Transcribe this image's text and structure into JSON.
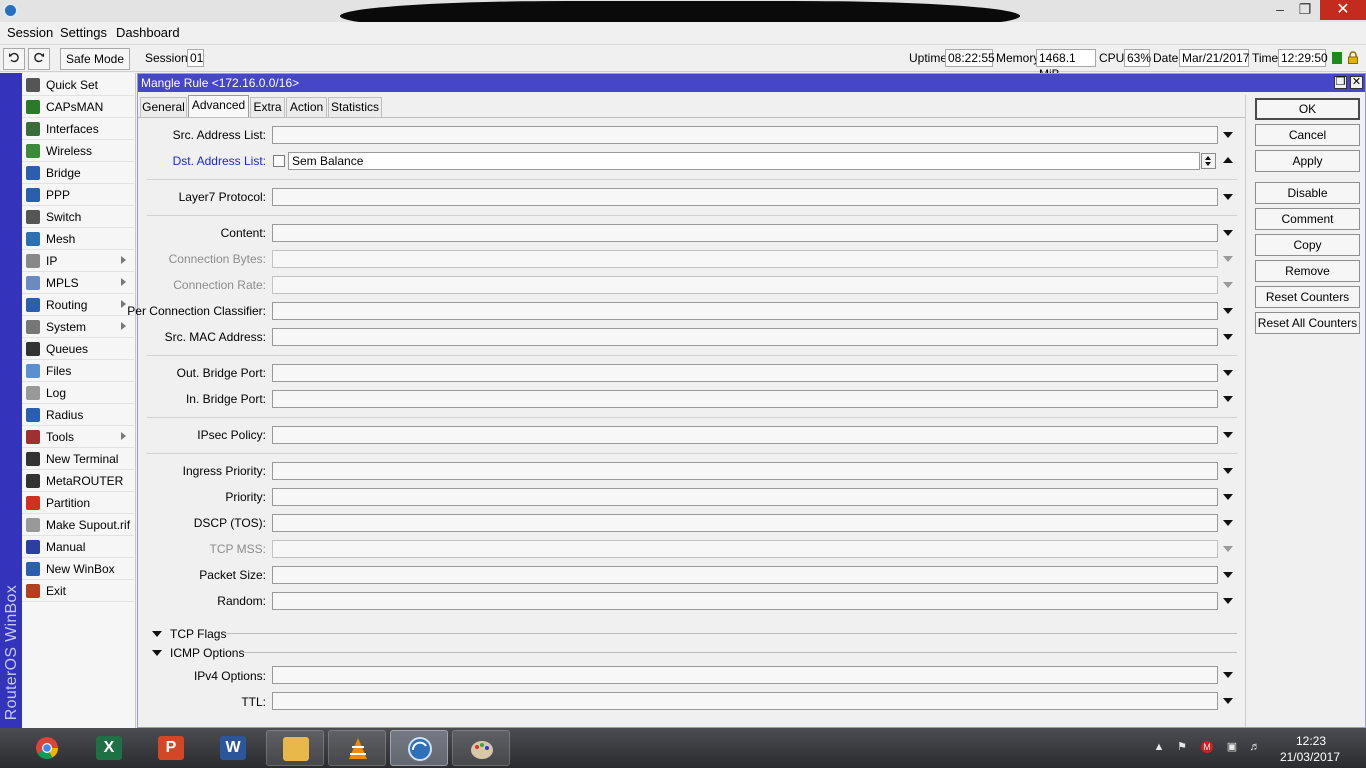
{
  "menubar": {
    "session": "Session",
    "settings": "Settings",
    "dashboard": "Dashboard"
  },
  "toolbar": {
    "safe_mode": "Safe Mode",
    "session_label": "Session:",
    "session_value": "01",
    "uptime_label": "Uptime:",
    "uptime_value": "08:22:55",
    "memory_label": "Memory:",
    "memory_value": "1468.1 MiB",
    "cpu_label": "CPU:",
    "cpu_value": "63%",
    "date_label": "Date:",
    "date_value": "Mar/21/2017",
    "time_label": "Time:",
    "time_value": "12:29:50"
  },
  "brand": "RouterOS WinBox",
  "sidebar": {
    "items": [
      {
        "label": "Quick Set",
        "icon": "quick-set-icon",
        "submenu": false
      },
      {
        "label": "CAPsMAN",
        "icon": "capsman-icon",
        "submenu": false
      },
      {
        "label": "Interfaces",
        "icon": "interfaces-icon",
        "submenu": false
      },
      {
        "label": "Wireless",
        "icon": "wireless-icon",
        "submenu": false
      },
      {
        "label": "Bridge",
        "icon": "bridge-icon",
        "submenu": false
      },
      {
        "label": "PPP",
        "icon": "ppp-icon",
        "submenu": false
      },
      {
        "label": "Switch",
        "icon": "switch-icon",
        "submenu": false
      },
      {
        "label": "Mesh",
        "icon": "mesh-icon",
        "submenu": false
      },
      {
        "label": "IP",
        "icon": "ip-icon",
        "submenu": true
      },
      {
        "label": "MPLS",
        "icon": "mpls-icon",
        "submenu": true
      },
      {
        "label": "Routing",
        "icon": "routing-icon",
        "submenu": true
      },
      {
        "label": "System",
        "icon": "system-icon",
        "submenu": true
      },
      {
        "label": "Queues",
        "icon": "queues-icon",
        "submenu": false
      },
      {
        "label": "Files",
        "icon": "files-icon",
        "submenu": false
      },
      {
        "label": "Log",
        "icon": "log-icon",
        "submenu": false
      },
      {
        "label": "Radius",
        "icon": "radius-icon",
        "submenu": false
      },
      {
        "label": "Tools",
        "icon": "tools-icon",
        "submenu": true
      },
      {
        "label": "New Terminal",
        "icon": "terminal-icon",
        "submenu": false
      },
      {
        "label": "MetaROUTER",
        "icon": "metarouter-icon",
        "submenu": false
      },
      {
        "label": "Partition",
        "icon": "partition-icon",
        "submenu": false
      },
      {
        "label": "Make Supout.rif",
        "icon": "supout-icon",
        "submenu": false
      },
      {
        "label": "Manual",
        "icon": "manual-icon",
        "submenu": false
      },
      {
        "label": "New WinBox",
        "icon": "winbox-icon",
        "submenu": false
      },
      {
        "label": "Exit",
        "icon": "exit-icon",
        "submenu": false
      }
    ]
  },
  "dialog": {
    "title": "Mangle Rule <172.16.0.0/16>",
    "tabs": [
      "General",
      "Advanced",
      "Extra",
      "Action",
      "Statistics"
    ],
    "active_tab": "Advanced",
    "fields": {
      "src_address_list": {
        "label": "Src. Address List:",
        "value": ""
      },
      "dst_address_list": {
        "label": "Dst. Address List:",
        "value": "Sem Balance",
        "negate": false
      },
      "layer7_protocol": {
        "label": "Layer7 Protocol:",
        "value": ""
      },
      "content": {
        "label": "Content:",
        "value": ""
      },
      "connection_bytes": {
        "label": "Connection Bytes:",
        "value": ""
      },
      "connection_rate": {
        "label": "Connection Rate:",
        "value": ""
      },
      "per_connection_classifier": {
        "label": "Per Connection Classifier:",
        "value": ""
      },
      "src_mac_address": {
        "label": "Src. MAC Address:",
        "value": ""
      },
      "out_bridge_port": {
        "label": "Out. Bridge Port:",
        "value": ""
      },
      "in_bridge_port": {
        "label": "In. Bridge Port:",
        "value": ""
      },
      "ipsec_policy": {
        "label": "IPsec Policy:",
        "value": ""
      },
      "ingress_priority": {
        "label": "Ingress Priority:",
        "value": ""
      },
      "priority": {
        "label": "Priority:",
        "value": ""
      },
      "dscp": {
        "label": "DSCP (TOS):",
        "value": ""
      },
      "tcp_mss": {
        "label": "TCP MSS:",
        "value": ""
      },
      "packet_size": {
        "label": "Packet Size:",
        "value": ""
      },
      "random": {
        "label": "Random:",
        "value": ""
      },
      "ipv4_options": {
        "label": "IPv4 Options:",
        "value": ""
      },
      "ttl": {
        "label": "TTL:",
        "value": ""
      }
    },
    "sections": {
      "tcp_flags": "TCP Flags",
      "icmp_options": "ICMP Options"
    },
    "buttons": {
      "ok": "OK",
      "cancel": "Cancel",
      "apply": "Apply",
      "disable": "Disable",
      "comment": "Comment",
      "copy": "Copy",
      "remove": "Remove",
      "reset_counters": "Reset Counters",
      "reset_all_counters": "Reset All Counters"
    }
  },
  "taskbar": {
    "apps": [
      "chrome-icon",
      "excel-icon",
      "powerpoint-icon",
      "word-icon",
      "file-explorer-icon",
      "vlc-icon",
      "winbox-icon",
      "paint-icon"
    ],
    "clock_time": "12:23",
    "clock_date": "21/03/2017"
  },
  "colors": {
    "brand_strip": "#3333bb",
    "title_bar": "#4646c8",
    "link_label": "#1a2acb",
    "close_button": "#c42b1c"
  }
}
